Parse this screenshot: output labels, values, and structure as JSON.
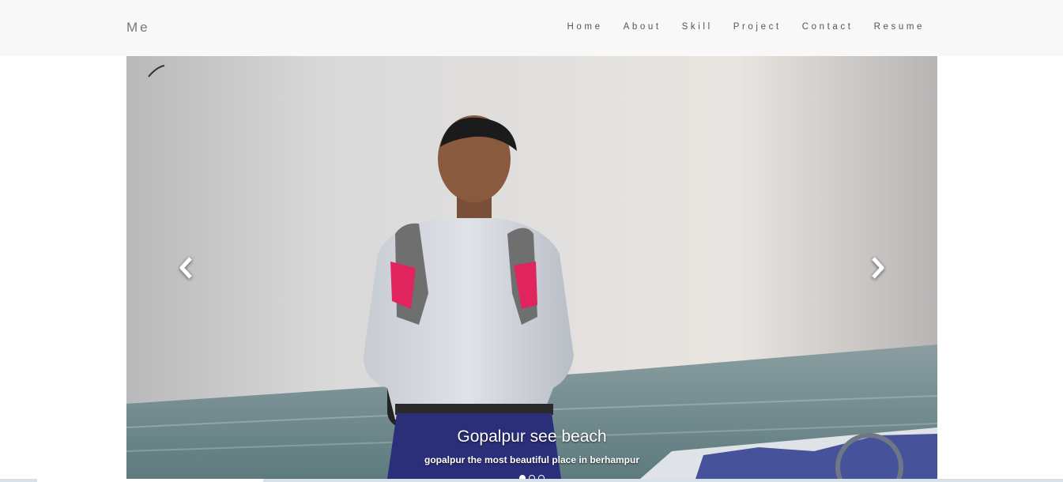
{
  "nav": {
    "brand": "Me",
    "links": [
      "Home",
      "About",
      "Skill",
      "Project",
      "Contact",
      "Resume"
    ]
  },
  "carousel": {
    "caption_title": "Gopalpur see beach",
    "caption_text": "gopalpur the most beautiful place in berhampur",
    "slide_count": 3,
    "active_index": 0,
    "prev_icon": "chevron-left-icon",
    "next_icon": "chevron-right-icon"
  },
  "colors": {
    "navbar_bg": "#f8f8f8",
    "nav_text": "#555555",
    "brand_text": "#777777",
    "caption_text": "#ffffff"
  }
}
